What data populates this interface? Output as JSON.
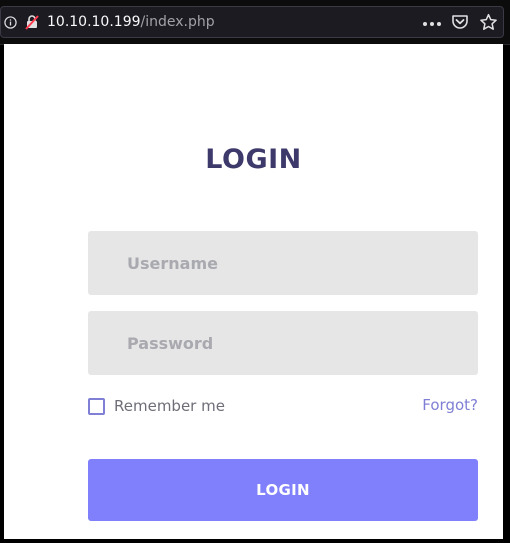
{
  "browser": {
    "url_host": "10.10.10.199",
    "url_path": "/index.php",
    "icons": [
      "info-icon",
      "insecure-connection-icon",
      "more-actions-icon",
      "pocket-icon",
      "bookmark-star-icon"
    ]
  },
  "login": {
    "title": "LOGIN",
    "username_placeholder": "Username",
    "password_placeholder": "Password",
    "remember_label": "Remember me",
    "forgot_label": "Forgot?",
    "submit_label": "LOGIN"
  },
  "colors": {
    "title": "#3d3a6b",
    "accent": "#8080fc",
    "field_bg": "#e6e6e6",
    "link": "#7f7fd5"
  }
}
